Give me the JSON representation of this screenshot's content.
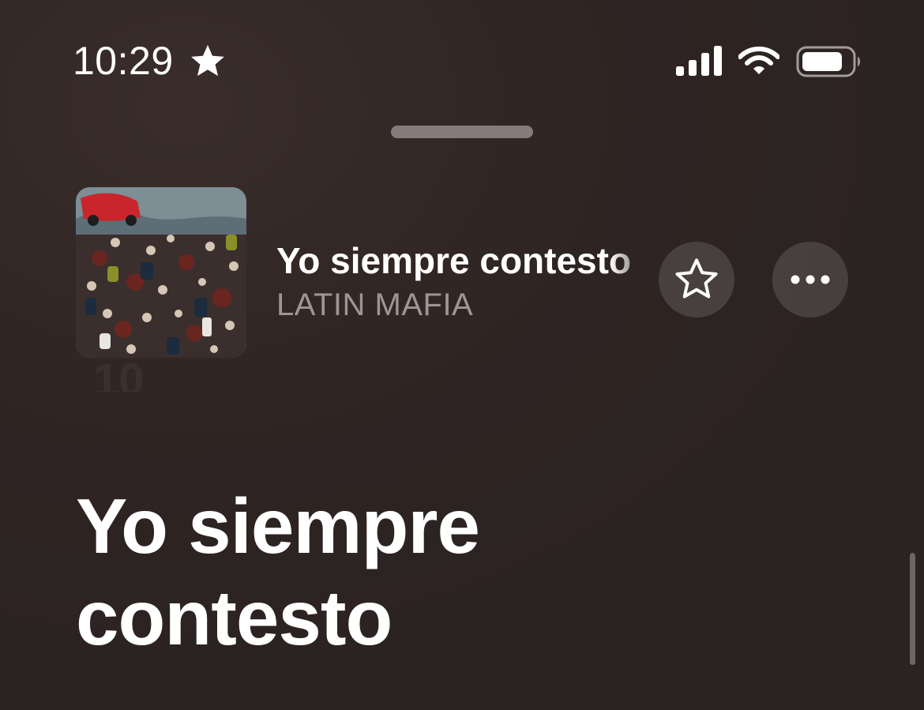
{
  "status_bar": {
    "time": "10:29",
    "location_icon": "star-icon",
    "signal_icon": "cellular-signal-icon",
    "wifi_icon": "wifi-icon",
    "battery_icon": "battery-icon"
  },
  "now_playing": {
    "title": "Yo siempre contesto",
    "artist": "LATIN MAFIA",
    "artwork_icon": "album-artwork-crowd-photo",
    "favorite_icon": "star-outline-icon",
    "more_icon": "ellipsis-icon",
    "background_number": "10"
  },
  "lyrics": {
    "lines": [
      "Yo siempre",
      "contesto"
    ]
  },
  "colors": {
    "background": "#2f2523",
    "secondary_text": "#9e9594",
    "button_fill": "rgba(255,255,255,0.13)"
  }
}
